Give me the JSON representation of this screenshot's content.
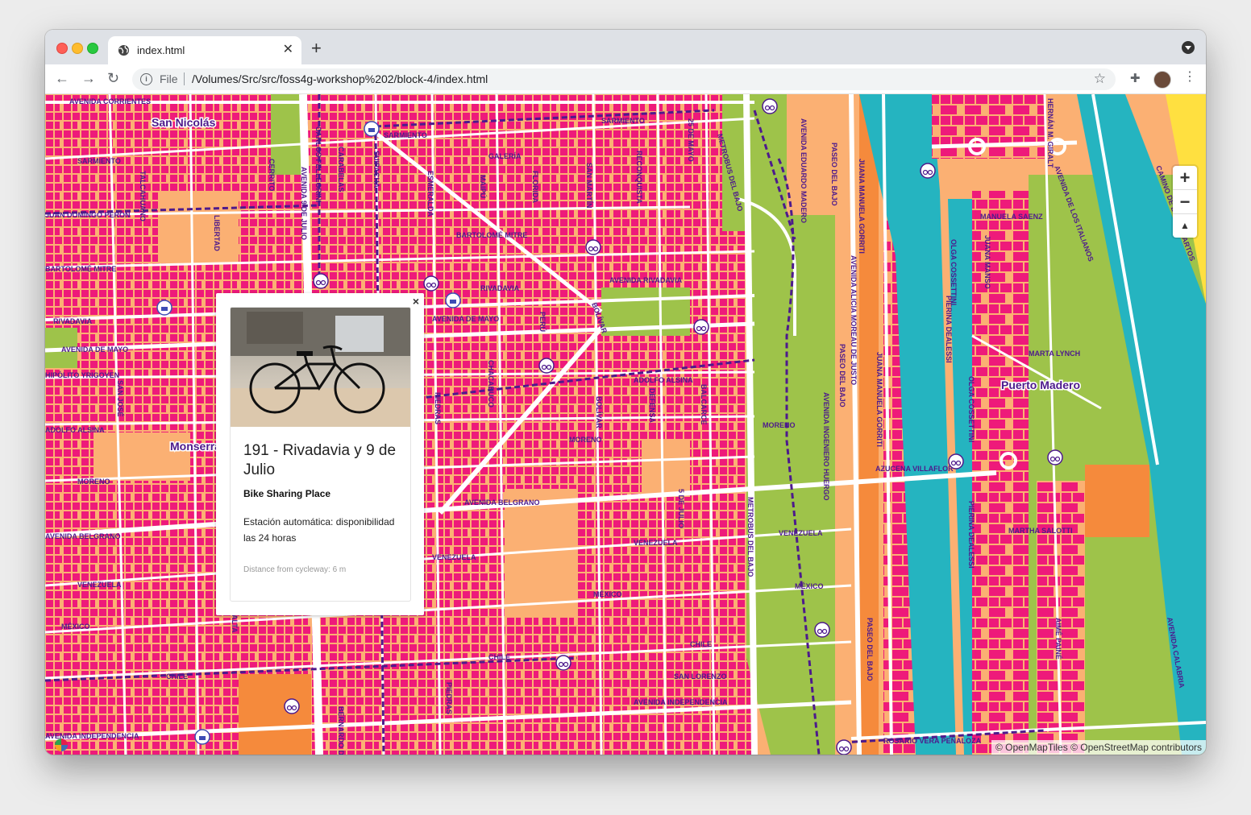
{
  "browser": {
    "tab_title": "index.html",
    "address_scheme": "File",
    "url": "/Volumes/Src/src/foss4g-workshop%202/block-4/index.html"
  },
  "map": {
    "zoom_in_label": "+",
    "zoom_out_label": "−",
    "reset_bearing_label": "▲",
    "attribution": "© OpenMapTiles © OpenStreetMap contributors",
    "districts": [
      "San Nicolás",
      "Monserrat",
      "Puerto Madero"
    ],
    "streets": {
      "corrientes": "AVENIDA CORRIENTES",
      "sarmiento": "SARMIENTO",
      "galeria": "GALERÍA",
      "peron": "JUAN DOMINGO PERÓN",
      "mitre": "BARTOLOMÉ MITRE",
      "rivadavia": "RIVADAVIA",
      "av_rivadavia": "AVENIDA RIVADAVIA",
      "av_mayo": "AVENIDA DE MAYO",
      "yrigoyen": "HIPÓLITO YRIGOYEN",
      "alsina": "ADOLFO ALSINA",
      "moreno": "MORENO",
      "belgrano": "AVENIDA BELGRANO",
      "venezuela": "VENEZUELA",
      "mexico": "MÉXICO",
      "chile": "CHILE",
      "san_lorenzo": "SAN LORENZO",
      "independencia": "AVENIDA INDEPENDENCIA",
      "rosario_vera": "ROSARIO VERA PEÑALOZA",
      "azucena": "AZUCENA VILLAFLOR",
      "martha": "MARTHA SALOTTI",
      "marta": "MARTA LYNCH",
      "manuela": "MANUELA SAENZ",
      "talcahuano": "TALCAHUANO",
      "libertad": "LIBERTAD",
      "cerrito": "CERRITO",
      "av_9_julio": "AVENIDA 9 DE JULIO",
      "pellegrini": "CARLOS PELLEGRINI",
      "carabelas": "CARABELAS",
      "suipacha": "SUIPACHA",
      "esmeralda": "ESMERALDA",
      "maipu": "MAIPÚ",
      "florida": "FLORIDA",
      "san_martin": "SAN MARTÍN",
      "reconquista": "RECONQUISTA",
      "mayo25": "25 DE MAYO",
      "metrobus": "METROBUS DEL BAJO",
      "madero": "AVENIDA EDUARDO MADERO",
      "paseo_bajo": "PASEO DEL BAJO",
      "gorriti": "JUANA MANUELA GORRITI",
      "alicia": "AVENIDA ALICIA MOREAU DE JUSTO",
      "huergo": "AVENIDA INGENIERO HUERGO",
      "olga": "OLGA COSSETTINI",
      "pierina": "PIERINA DEALESSI",
      "juana_manso": "JUANA MANSO",
      "giralt": "HERNÁN M. GIRALT",
      "italianos": "AVENIDA DE LOS ITALIANOS",
      "lagartos": "CAMINO DE LOS LAGARTOS",
      "calabria": "AVENIDA CALABRIA",
      "aime": "AIMÉ PAINÉ",
      "peru": "PERÚ",
      "bolivar": "BOLÍVAR",
      "chacabuco": "CHACABUCO",
      "piedras": "PIEDRAS",
      "defensa": "DEFENSA",
      "balcarce": "BALCARCE",
      "julio5": "5 DE JULIO",
      "san_jose": "SAN JOSÉ",
      "salta": "SALTA",
      "bernardo": "BERNARDO D"
    }
  },
  "popup": {
    "close_label": "×",
    "title": "191 - Rivadavia y 9 de Julio",
    "category": "Bike Sharing Place",
    "description": "Estación automática: disponibilidad las 24 horas",
    "distance": "Distance from cycleway: 6 m"
  },
  "colors": {
    "blocks": "#ee1a7a",
    "land": "#fbb073",
    "park": "#9ec34a",
    "water": "#25b4c0",
    "cycleway": "#4d1a8c",
    "roads": "#ffffff",
    "expressway": "#f58a3c",
    "coast": "#ffe040"
  }
}
